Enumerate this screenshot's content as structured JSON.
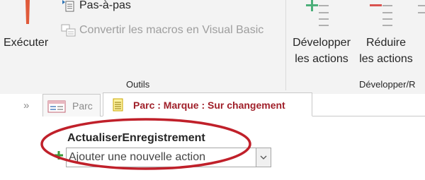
{
  "ribbon": {
    "run_label": "Exécuter",
    "step_label": "Pas-à-pas",
    "convert_label": "Convertir les macros en Visual Basic",
    "tools_group_label": "Outils",
    "expand": {
      "line1": "Développer",
      "line2": "les actions"
    },
    "collapse": {
      "line1": "Réduire",
      "line2": "les actions"
    },
    "expand_group_label": "Développer/R"
  },
  "tabs": {
    "overflow_label": "»",
    "items": [
      {
        "label": "Parc",
        "icon": "form-icon",
        "active": false
      },
      {
        "label": "Parc : Marque : Sur changement",
        "icon": "macro-icon",
        "active": true
      }
    ]
  },
  "designer": {
    "action_name": "ActualiserEnregistrement",
    "new_action_value": "Ajouter une nouvelle action"
  },
  "colors": {
    "accent_red": "#c0202a",
    "active_tab_text": "#a0202a",
    "plus_green": "#3a9a3a"
  }
}
